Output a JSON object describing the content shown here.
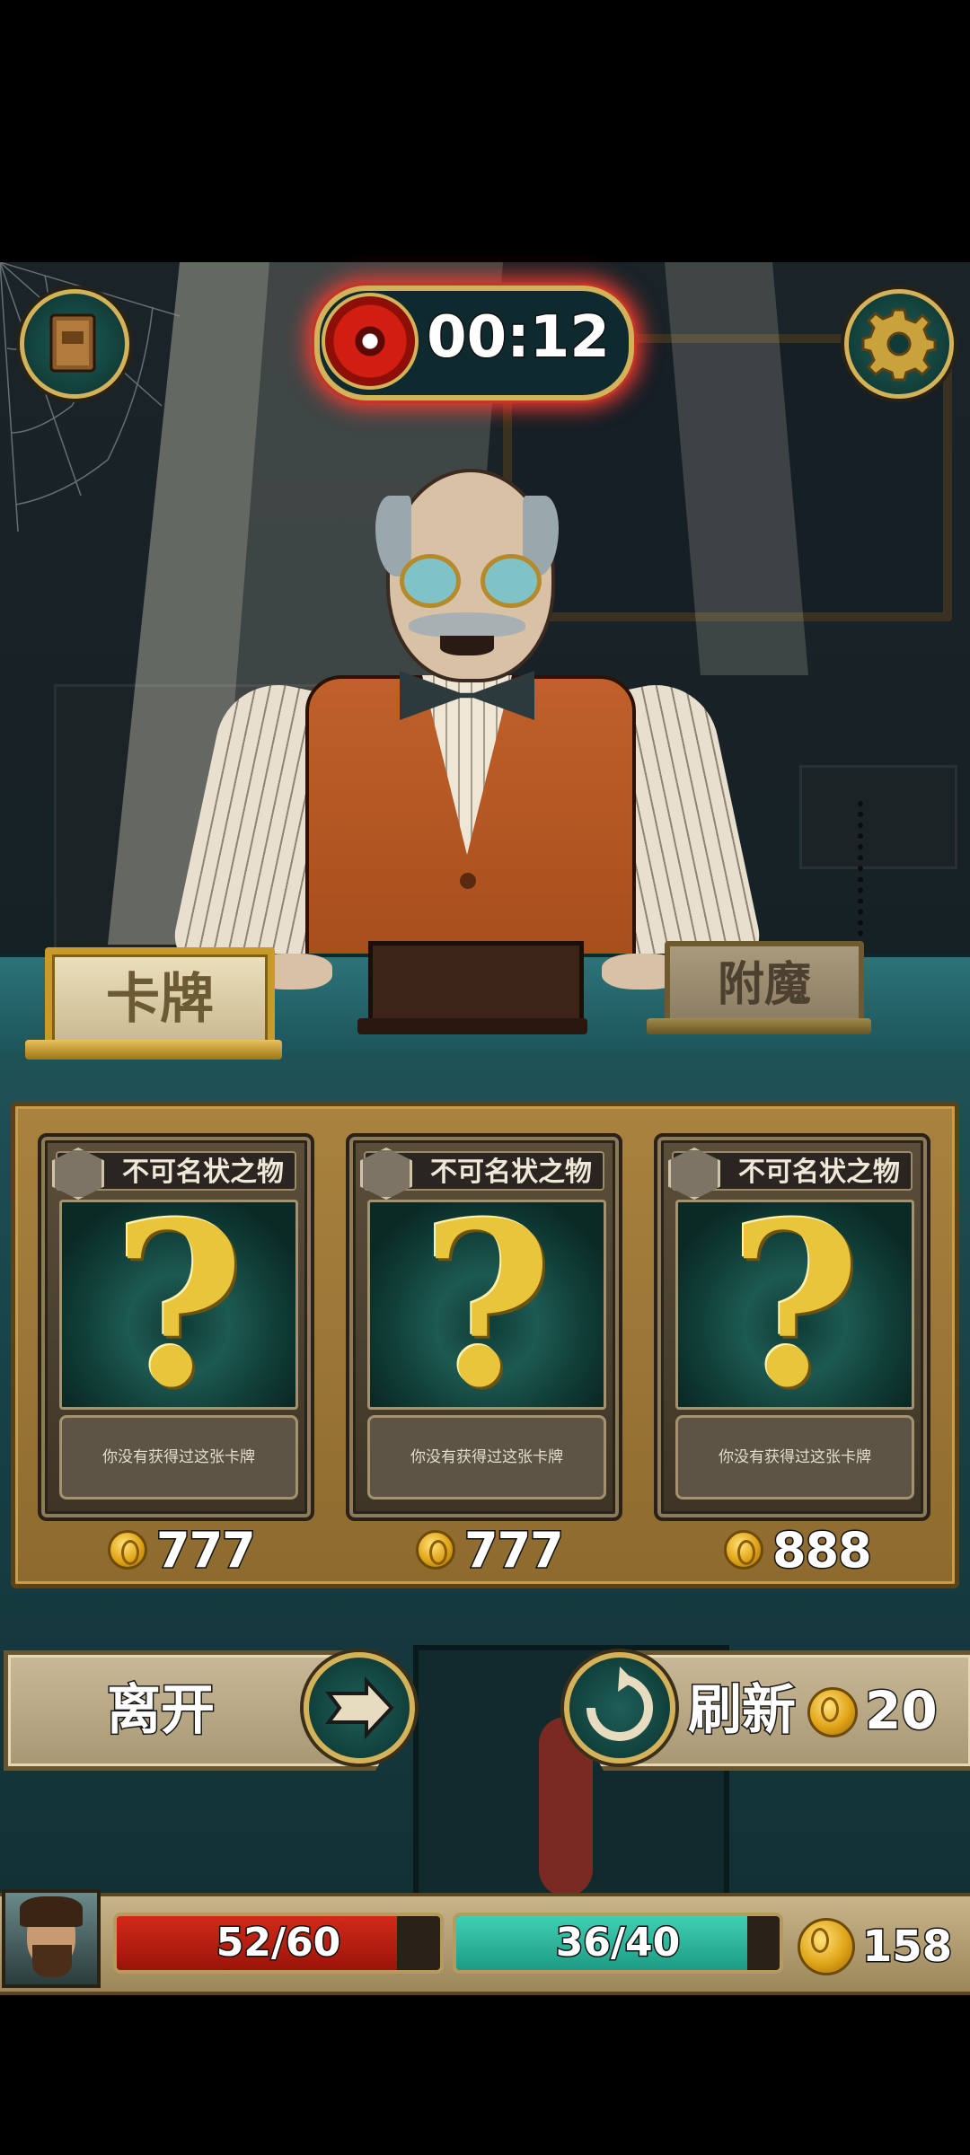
{
  "top": {
    "timer": "00:12",
    "book_icon": "spellbook-icon",
    "settings_icon": "gear-icon",
    "timer_icon": "eye-icon"
  },
  "signs": {
    "left": "卡牌",
    "right": "附魔"
  },
  "cards": [
    {
      "title": "不可名状之物",
      "description": "你没有获得过这张卡牌",
      "price": "777"
    },
    {
      "title": "不可名状之物",
      "description": "你没有获得过这张卡牌",
      "price": "777"
    },
    {
      "title": "不可名状之物",
      "description": "你没有获得过这张卡牌",
      "price": "888"
    }
  ],
  "buttons": {
    "leave_label": "离开",
    "refresh_label": "刷新",
    "refresh_cost": "20"
  },
  "status": {
    "hp_text": "52/60",
    "hp_fraction": 0.8667,
    "mp_text": "36/40",
    "mp_fraction": 0.9,
    "gold": "158"
  },
  "colors": {
    "hp": "#c21f12",
    "mp": "#2fc2a6",
    "gold": "#e0a418",
    "timer_glow": "#ff3b2f"
  }
}
